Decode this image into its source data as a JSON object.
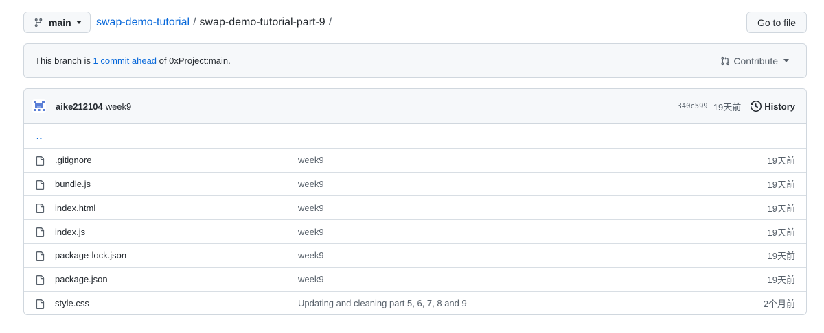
{
  "branch": {
    "name": "main"
  },
  "breadcrumb": {
    "repo": "swap-demo-tutorial",
    "separator": "/",
    "folder": "swap-demo-tutorial-part-9",
    "trailing": "/"
  },
  "goto_file_label": "Go to file",
  "branch_info": {
    "prefix": "This branch is",
    "link": "1 commit ahead",
    "suffix": "of 0xProject:main."
  },
  "contribute_label": "Contribute",
  "latest_commit": {
    "author": "aike212104",
    "message": "week9",
    "sha": "340c599",
    "ago": "19天前",
    "history_label": "History"
  },
  "parent_dir": "..",
  "files": [
    {
      "name": ".gitignore",
      "message": "week9",
      "age": "19天前"
    },
    {
      "name": "bundle.js",
      "message": "week9",
      "age": "19天前"
    },
    {
      "name": "index.html",
      "message": "week9",
      "age": "19天前"
    },
    {
      "name": "index.js",
      "message": "week9",
      "age": "19天前"
    },
    {
      "name": "package-lock.json",
      "message": "week9",
      "age": "19天前"
    },
    {
      "name": "package.json",
      "message": "week9",
      "age": "19天前"
    },
    {
      "name": "style.css",
      "message": "Updating and cleaning part 5, 6, 7, 8 and 9",
      "age": "2个月前"
    }
  ],
  "colors": {
    "link": "#0969da",
    "border": "#d0d7de",
    "header_bg": "#f6f8fa",
    "muted": "#57606a"
  }
}
